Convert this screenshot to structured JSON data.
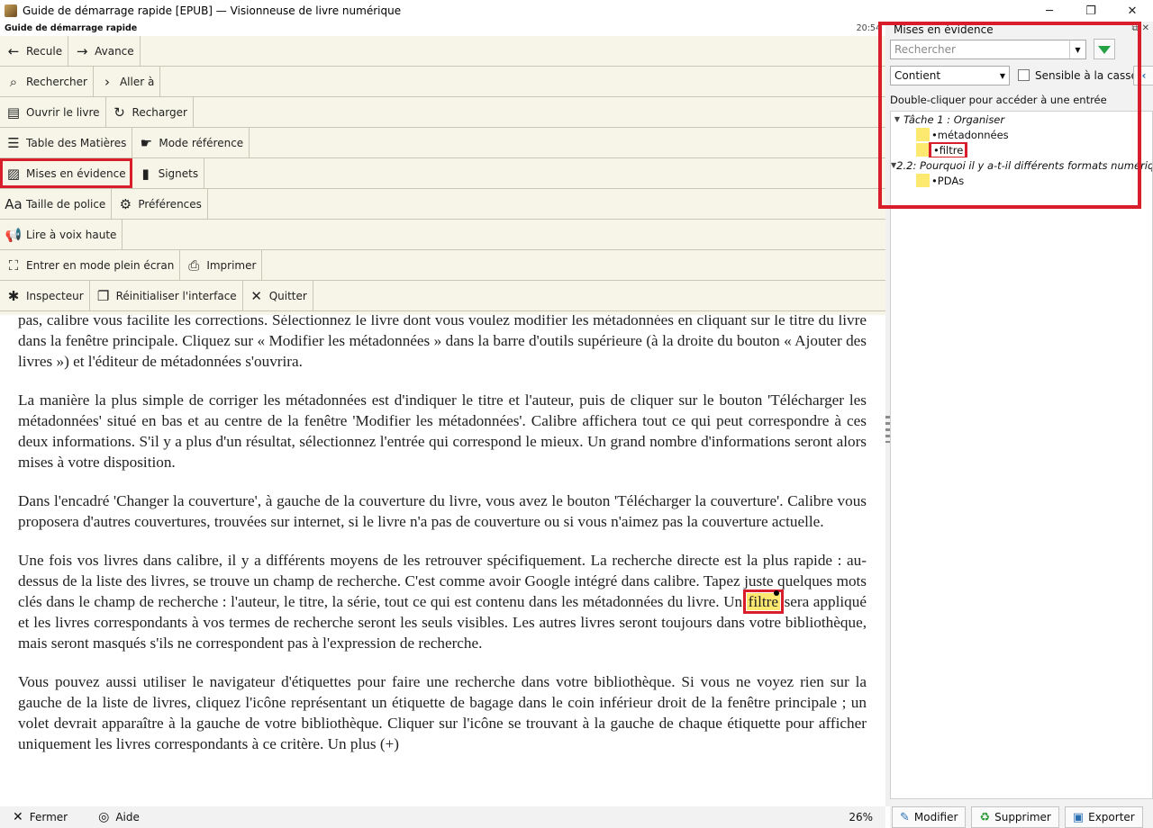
{
  "window": {
    "title": "Guide de démarrage rapide [EPUB] — Visionneuse de livre numérique",
    "min": "─",
    "max": "❐",
    "close": "✕"
  },
  "reader": {
    "book_title": "Guide de démarrage rapide",
    "time": "20:54"
  },
  "menu": {
    "rows": [
      [
        {
          "label": "Recule",
          "icon": "←"
        },
        {
          "label": "Avance",
          "icon": "→"
        }
      ],
      [
        {
          "label": "Rechercher",
          "icon": "⌕"
        },
        {
          "label": "Aller à",
          "icon": "›"
        }
      ],
      [
        {
          "label": "Ouvrir le livre",
          "icon": "▤"
        },
        {
          "label": "Recharger",
          "icon": "↻"
        }
      ],
      [
        {
          "label": "Table des Matières",
          "icon": "☰"
        },
        {
          "label": "Mode référence",
          "icon": "☛"
        }
      ],
      [
        {
          "label": "Mises en évidence",
          "icon": "▨"
        },
        {
          "label": "Signets",
          "icon": "▮"
        }
      ],
      [
        {
          "label": "Taille de police",
          "icon": "Aa"
        },
        {
          "label": "Préférences",
          "icon": "⚙"
        }
      ],
      [
        {
          "label": "Lire à voix haute",
          "icon": "📢"
        }
      ],
      [
        {
          "label": "Entrer en mode plein écran",
          "icon": "⛶"
        },
        {
          "label": "Imprimer",
          "icon": "⎙"
        }
      ],
      [
        {
          "label": "Inspecteur",
          "icon": "✱"
        },
        {
          "label": "Réinitialiser l'interface",
          "icon": "❐"
        },
        {
          "label": "Quitter",
          "icon": "✕"
        }
      ]
    ]
  },
  "content": {
    "p1": "pas, calibre vous facilite les corrections. Sélectionnez le livre dont vous voulez modifier les métadonnées en cliquant sur le titre du livre dans la fenêtre principale. Cliquez sur « Modifier les métadonnées » dans la barre d'outils supérieure (à la droite du bouton « Ajouter des livres ») et l'éditeur de métadonnées s'ouvrira.",
    "p2": "La manière la plus simple de corriger les métadonnées est d'indiquer le titre et l'auteur, puis de cliquer sur le bouton 'Télécharger les métadonnées' situé en bas et au centre de la fenêtre 'Modifier les métadonnées'. Calibre affichera tout ce qui peut correspondre à ces deux informations. S'il y a plus d'un résultat, sélectionnez l'entrée qui correspond le mieux. Un grand nombre d'informations seront alors mises à votre disposition.",
    "p3": "Dans l'encadré 'Changer la couverture', à gauche de la couverture du livre, vous avez le bouton 'Télécharger la couverture'. Calibre vous proposera d'autres couvertures, trouvées sur internet, si le livre n'a pas de couverture ou si vous n'aimez pas la couverture actuelle.",
    "p4_before": "Une fois vos livres dans calibre, il y a différents moyens de les retrouver spécifiquement. La recherche directe est la plus rapide : au-dessus de la liste des livres, se trouve un champ de recherche. C'est comme avoir Google intégré dans calibre. Tapez juste quelques mots clés dans le champ de recherche : l'auteur, le titre, la série, tout ce qui est contenu dans les métadonnées du livre. Un ",
    "p4_highlight": "filtre",
    "p4_after": " sera appliqué et les livres correspondants à vos termes de recherche seront les seuls visibles. Les autres livres seront toujours dans votre bibliothèque, mais seront masqués s'ils ne correspondent pas à l'expression de recherche.",
    "p5": "Vous pouvez aussi utiliser le navigateur d'étiquettes pour faire une recherche dans votre bibliothèque. Si vous ne voyez rien sur la gauche de la liste de livres, cliquez l'icône représentant un étiquette de bagage dans le coin inférieur droit de la fenêtre principale ; un volet devrait apparaître à la gauche de votre bibliothèque. Cliquer sur l'icône se trouvant à la gauche de chaque étiquette pour afficher uniquement les livres correspondants à ce critère. Un plus (+)"
  },
  "status": {
    "close_label": "Fermer",
    "help_label": "Aide",
    "percent": "26%"
  },
  "panel": {
    "title": "Mises en évidence",
    "search_placeholder": "Rechercher",
    "mode_value": "Contient",
    "case_label": "Sensible à la casse",
    "hint": "Double-cliquer pour accéder à une entrée",
    "groups": [
      {
        "title": "Tâche 1 : Organiser",
        "items": [
          "•métadonnées",
          "•filtre"
        ]
      },
      {
        "title": "2.2: Pourquoi il y a-t-il différents formats numériq…",
        "items": [
          "•PDAs"
        ]
      }
    ],
    "highlight_color": "#fde870",
    "buttons": {
      "edit": "Modifier",
      "delete": "Supprimer",
      "export": "Exporter"
    }
  },
  "accent_red": "#d81e2a"
}
